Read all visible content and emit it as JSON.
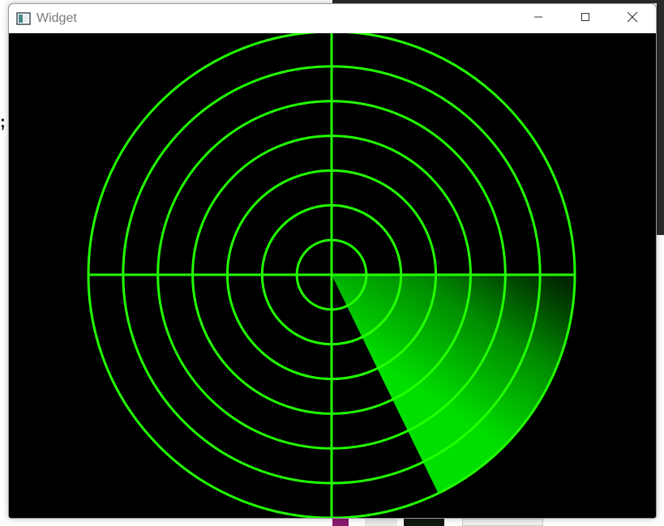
{
  "window": {
    "title": "Widget",
    "app_icon": "qt-window-icon",
    "controls": {
      "minimize_icon": "minimize-icon",
      "maximize_icon": "maximize-icon",
      "close_icon": "close-icon"
    }
  },
  "radar": {
    "background_color": "#000000",
    "line_color": "#22ff00",
    "sweep_color": "#00dd00",
    "ring_count": 7,
    "sweep_start_deg": 0,
    "sweep_end_deg": 64
  },
  "background": {
    "left_glyph": ";"
  }
}
